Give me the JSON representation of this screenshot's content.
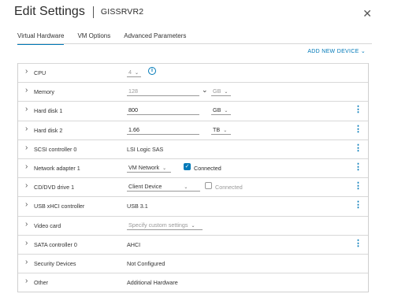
{
  "header": {
    "title": "Edit Settings",
    "vm_name": "GISSRVR2"
  },
  "tabs": [
    {
      "label": "Virtual Hardware"
    },
    {
      "label": "VM Options"
    },
    {
      "label": "Advanced Parameters"
    }
  ],
  "toolbar": {
    "add_device": "ADD NEW DEVICE"
  },
  "rows": {
    "cpu": {
      "label": "CPU",
      "value": "4"
    },
    "memory": {
      "label": "Memory",
      "value": "128",
      "unit": "GB"
    },
    "hard_disk_1": {
      "label": "Hard disk 1",
      "value": "800",
      "unit": "GB"
    },
    "hard_disk_2": {
      "label": "Hard disk 2",
      "value": "1.66",
      "unit": "TB"
    },
    "scsi": {
      "label": "SCSI controller 0",
      "value": "LSI Logic SAS"
    },
    "network": {
      "label": "Network adapter 1",
      "value": "VM Network",
      "connected_label": "Connected"
    },
    "cddvd": {
      "label": "CD/DVD drive 1",
      "value": "Client Device",
      "connected_label": "Connected"
    },
    "usb": {
      "label": "USB xHCI controller",
      "value": "USB 3.1"
    },
    "video": {
      "label": "Video card",
      "value": "Specify custom settings"
    },
    "sata": {
      "label": "SATA controller 0",
      "value": "AHCI"
    },
    "security": {
      "label": "Security Devices",
      "value": "Not Configured"
    },
    "other": {
      "label": "Other",
      "value": "Additional Hardware"
    }
  },
  "icons": {
    "close": "close-icon",
    "expand": "chevron-right-icon",
    "more": "more-vertical-icon",
    "info": "info-icon",
    "checkbox": "checkbox-icon"
  },
  "colors": {
    "accent": "#0079b8"
  }
}
